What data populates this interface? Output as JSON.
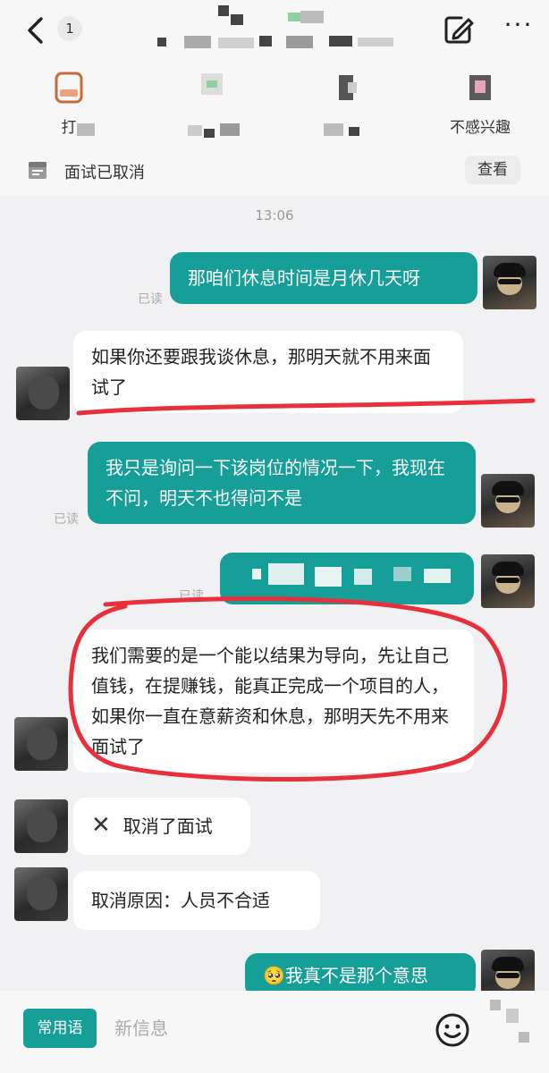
{
  "header": {
    "unread_count": "1",
    "more_glyph": "···",
    "back_icon": "chevron-left-icon",
    "edit_icon": "edit-note-icon"
  },
  "actions": [
    {
      "label": "打",
      "icon": "phone-card-icon"
    },
    {
      "label": "",
      "icon": "resume-icon"
    },
    {
      "label": "",
      "icon": "exchange-icon"
    },
    {
      "label": "不感兴趣",
      "icon": "not-interested-icon"
    }
  ],
  "status": {
    "text": "面试已取消",
    "view_label": "查看"
  },
  "chat": {
    "timestamp": "13:06",
    "messages": [
      {
        "side": "out",
        "text": "那咱们休息时间是月休几天呀",
        "read": "已读"
      },
      {
        "side": "in",
        "text": "如果你还要跟我谈休息，那明天就不用来面试了"
      },
      {
        "side": "out",
        "text": "我只是询问一下该岗位的情况一下，我现在不问，明天不也得问不是",
        "read": "已读"
      },
      {
        "side": "out",
        "text": "",
        "read": "已读"
      },
      {
        "side": "in",
        "text": "我们需要的是一个能以结果为导向，先让自己值钱，在提赚钱，能真正完成一个项目的人，如果你一直在意薪资和休息，那明天先不用来面试了"
      },
      {
        "side": "in",
        "text": "取消了面试",
        "icon": "close-icon"
      },
      {
        "side": "in",
        "text": "取消原因：人员不合适"
      },
      {
        "side": "out",
        "text": "我真不是那个意思",
        "emoji": "🥺"
      }
    ]
  },
  "input": {
    "phrase_label": "常用语",
    "placeholder": "新信息",
    "emoji_icon": "smiley-icon"
  },
  "colors": {
    "accent": "#169e99",
    "annotation": "#e8303a",
    "background": "#f1f1f3"
  }
}
